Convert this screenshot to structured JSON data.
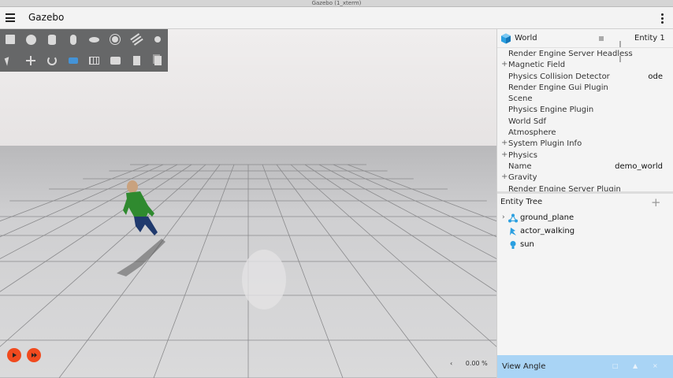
{
  "window": {
    "title": "Gazebo (1_xterm)"
  },
  "app": {
    "title": "Gazebo"
  },
  "toolbar": {
    "shapes": [
      "box-icon",
      "sphere-icon",
      "cylinder-icon",
      "capsule-icon",
      "ellipsoid-icon",
      "sun-light-icon",
      "directional-light-icon",
      "spot-light-icon"
    ],
    "transform": [
      "select-icon",
      "translate-icon",
      "rotate-icon",
      "view-angle-icon",
      "grid-icon",
      "screenshot-icon",
      "copy-icon",
      "paste-icon"
    ]
  },
  "playback": {
    "play_icon": "play-icon",
    "step_icon": "step-icon"
  },
  "rtf": {
    "arrow": "‹",
    "value": "0.00 %"
  },
  "component_inspector": {
    "title": "World",
    "entity": "Entity 1",
    "rows": [
      {
        "plus": "",
        "label": "Render Engine Server Headless",
        "value": ""
      },
      {
        "plus": "+",
        "label": "Magnetic Field",
        "value": ""
      },
      {
        "plus": "",
        "label": "Physics Collision Detector",
        "value": "ode"
      },
      {
        "plus": "",
        "label": "Render Engine Gui Plugin",
        "value": ""
      },
      {
        "plus": "",
        "label": "Scene",
        "value": ""
      },
      {
        "plus": "",
        "label": "Physics Engine Plugin",
        "value": ""
      },
      {
        "plus": "",
        "label": "World Sdf",
        "value": ""
      },
      {
        "plus": "",
        "label": "Atmosphere",
        "value": ""
      },
      {
        "plus": "+",
        "label": "System Plugin Info",
        "value": ""
      },
      {
        "plus": "+",
        "label": "Physics",
        "value": ""
      },
      {
        "plus": "",
        "label": "Name",
        "value": "demo_world"
      },
      {
        "plus": "+",
        "label": "Gravity",
        "value": ""
      },
      {
        "plus": "",
        "label": "Render Engine Server Plugin",
        "value": ""
      }
    ]
  },
  "entity_tree": {
    "title": "Entity Tree",
    "add": "+",
    "items": [
      {
        "chevron": "›",
        "name": "ground_plane",
        "icon": "model-icon"
      },
      {
        "chevron": "",
        "name": "actor_walking",
        "icon": "actor-icon"
      },
      {
        "chevron": "",
        "name": "sun",
        "icon": "light-bulb-icon"
      }
    ]
  },
  "view_angle": {
    "title": "View Angle",
    "controls": [
      "□",
      "▲",
      "×"
    ]
  },
  "colors": {
    "accent": "#f04a1e",
    "panel_blue": "#a9d4f5",
    "toolbar": "#5f6061"
  }
}
